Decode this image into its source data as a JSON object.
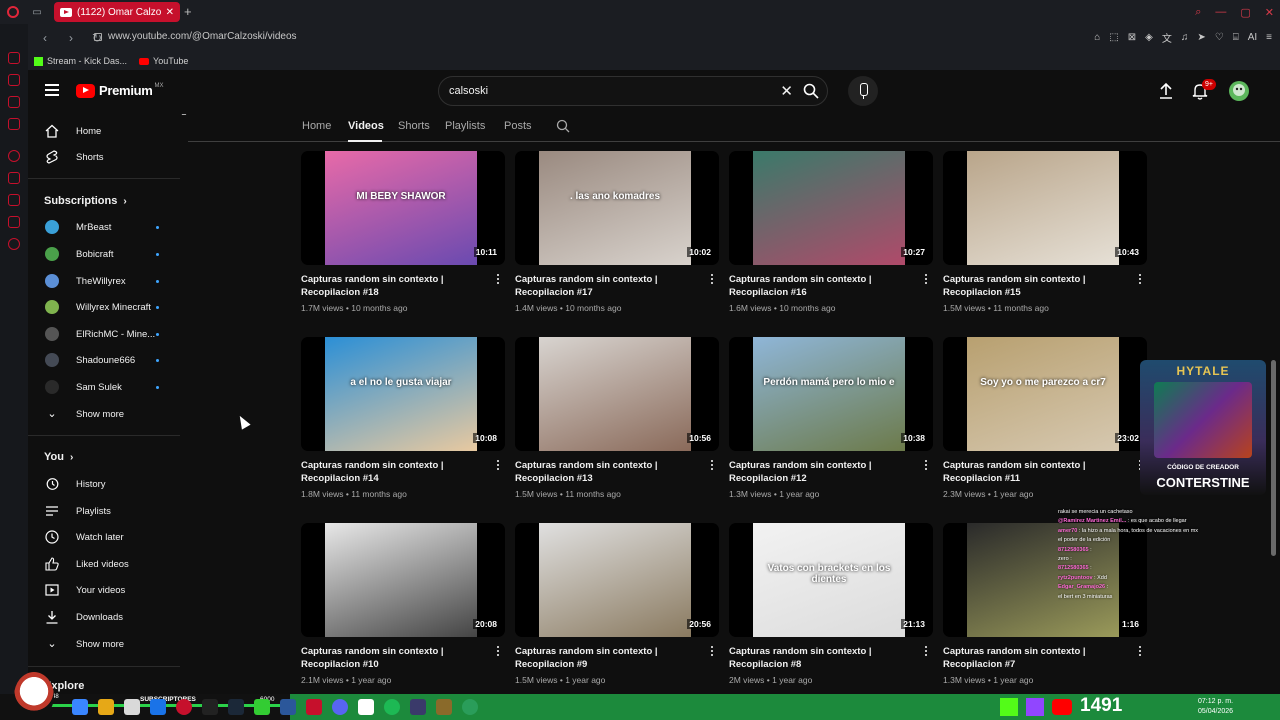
{
  "browser": {
    "tab_title": "(1122) Omar Calzoski - You",
    "url": "www.youtube.com/@OmarCalzoski/videos",
    "bookmarks": [
      {
        "label": "Stream - Kick Das..."
      },
      {
        "label": "YouTube"
      }
    ],
    "toolbar_right_label": "AI"
  },
  "header": {
    "logo_text": "Premium",
    "logo_region": "MX",
    "search_value": "calsoski",
    "notification_count": "9+"
  },
  "sidebar": {
    "main": [
      {
        "label": "Home",
        "icon": "home-icon"
      },
      {
        "label": "Shorts",
        "icon": "shorts-icon"
      }
    ],
    "subscriptions_title": "Subscriptions",
    "subscriptions": [
      {
        "label": "MrBeast",
        "color": "#3aa0d8"
      },
      {
        "label": "Bobicraft",
        "color": "#4aa04a"
      },
      {
        "label": "TheWillyrex",
        "color": "#5b8fd6"
      },
      {
        "label": "Willyrex Minecraft",
        "color": "#7fb34e"
      },
      {
        "label": "ElRichMC - Mine...",
        "color": "#333333"
      },
      {
        "label": "Shadoune666",
        "color": "#444a55"
      },
      {
        "label": "Sam Sulek",
        "color": "#222222"
      }
    ],
    "subs_show_more": "Show more",
    "you_title": "You",
    "you_items": [
      {
        "label": "History",
        "icon": "history-icon"
      },
      {
        "label": "Playlists",
        "icon": "playlists-icon"
      },
      {
        "label": "Watch later",
        "icon": "watch-later-icon"
      },
      {
        "label": "Liked videos",
        "icon": "liked-icon"
      },
      {
        "label": "Your videos",
        "icon": "your-videos-icon"
      },
      {
        "label": "Downloads",
        "icon": "download-icon"
      }
    ],
    "you_show_more": "Show more",
    "explore_title": "Explore"
  },
  "channel_tabs": [
    "Home",
    "Videos",
    "Shorts",
    "Playlists",
    "Posts"
  ],
  "active_tab": "Videos",
  "videos": [
    {
      "title": "Capturas random sin contexto | Recopilacion #18",
      "views": "1.7M views",
      "age": "10 months ago",
      "duration": "10:11",
      "colors": [
        "#e86aa8",
        "#6a4ab0"
      ],
      "overlay": "MI BEBY SHAWOR"
    },
    {
      "title": "Capturas random sin contexto | Recopilacion #17",
      "views": "1.4M views",
      "age": "10 months ago",
      "duration": "10:02",
      "colors": [
        "#9a8a80",
        "#d8d2cc"
      ],
      "overlay": ". las ano komadres"
    },
    {
      "title": "Capturas random sin contexto | Recopilacion #16",
      "views": "1.6M views",
      "age": "10 months ago",
      "duration": "10:27",
      "colors": [
        "#3a7a6a",
        "#b04a6a"
      ],
      "overlay": ""
    },
    {
      "title": "Capturas random sin contexto | Recopilacion #15",
      "views": "1.5M views",
      "age": "11 months ago",
      "duration": "10:43",
      "colors": [
        "#b9a58a",
        "#e6e0d6"
      ],
      "overlay": ""
    },
    {
      "title": "Capturas random sin contexto | Recopilacion #14",
      "views": "1.8M views",
      "age": "11 months ago",
      "duration": "10:08",
      "colors": [
        "#2b8fd6",
        "#e8c9a0"
      ],
      "overlay": "a el no le gusta viajar"
    },
    {
      "title": "Capturas random sin contexto | Recopilacion #13",
      "views": "1.5M views",
      "age": "11 months ago",
      "duration": "10:56",
      "colors": [
        "#d8d4d0",
        "#8a6a5a"
      ],
      "overlay": ""
    },
    {
      "title": "Capturas random sin contexto | Recopilacion #12",
      "views": "1.3M views",
      "age": "1 year ago",
      "duration": "10:38",
      "colors": [
        "#8fb6d8",
        "#6c7a4a"
      ],
      "overlay": "Perdón mamá pero lo mio e"
    },
    {
      "title": "Capturas random sin contexto | Recopilacion #11",
      "views": "2.3M views",
      "age": "1 year ago",
      "duration": "23:02",
      "colors": [
        "#b8a070",
        "#d6c8b0"
      ],
      "overlay": "Soy yo o me parezco a cr7"
    },
    {
      "title": "Capturas random sin contexto | Recopilacion #10",
      "views": "2.1M views",
      "age": "1 year ago",
      "duration": "20:08",
      "colors": [
        "#e8e8e8",
        "#444444"
      ],
      "overlay": ""
    },
    {
      "title": "Capturas random sin contexto | Recopilacion #9",
      "views": "1.5M views",
      "age": "1 year ago",
      "duration": "20:56",
      "colors": [
        "#e0e0e0",
        "#8a7a60"
      ],
      "overlay": ""
    },
    {
      "title": "Capturas random sin contexto | Recopilacion #8",
      "views": "2M views",
      "age": "1 year ago",
      "duration": "21:13",
      "colors": [
        "#f2f2f2",
        "#dcdcdc"
      ],
      "overlay": "Vatos con brackets en los dientes"
    },
    {
      "title": "Capturas random sin contexto | Recopilacion #7",
      "views": "1.3M views",
      "age": "1 year ago",
      "duration": "1:16",
      "colors": [
        "#2a2a2a",
        "#9a9a5a"
      ],
      "overlay": ""
    }
  ],
  "overlay": {
    "hytale_title": "HYTALE",
    "creator_code_label": "CÓDIGO DE CREADOR",
    "creator_code": "CONTERSTINE",
    "chat": [
      {
        "user": "",
        "text": "rakai se merecia un cachetaso"
      },
      {
        "user": "@Ramirez Martinez Emil...",
        "text": ": es que acabo de llegar"
      },
      {
        "user": "amer70",
        "text": ": la hizo a mala hora, todos de vacaciones en mx"
      },
      {
        "user": "",
        "text": "el poder de la edición"
      },
      {
        "user": "8712580365",
        "text": ":"
      },
      {
        "user": "",
        "text": "zero :"
      },
      {
        "user": "",
        "text": ""
      },
      {
        "user": "8712580365",
        "text": ":"
      },
      {
        "user": "rytz2puntoov",
        "text": ": Xdd"
      },
      {
        "user": "Edgar_Gramajo26",
        "text": ":"
      },
      {
        "user": "",
        "text": "el bert en 3 miniaturas"
      }
    ]
  },
  "taskbar": {
    "subs_label": "SUBSCRIPTORES",
    "subs_goal": "6000",
    "subs_current": "48",
    "counter": "1491",
    "time": "07:12 p. m.",
    "date": "05/04/2026"
  }
}
